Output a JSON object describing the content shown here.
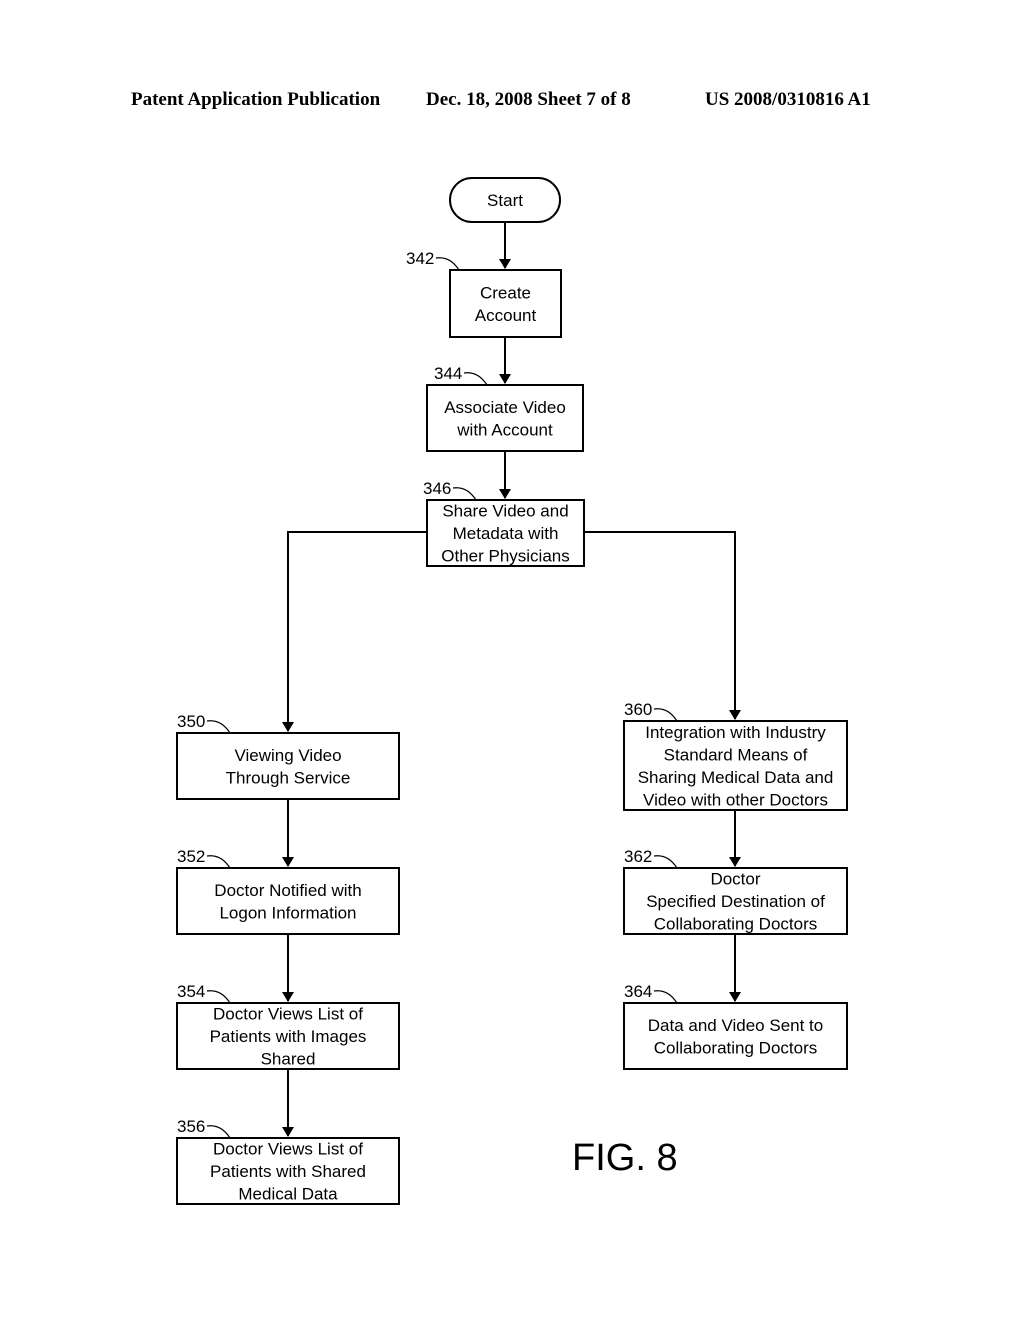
{
  "header": {
    "left": "Patent Application Publication",
    "middle": "Dec. 18, 2008   Sheet 7 of 8",
    "right": "US 2008/0310816 A1"
  },
  "figure_label": "FIG. 8",
  "start": {
    "label": "Start"
  },
  "steps": {
    "s342": {
      "ref": "342",
      "lines": [
        "Create",
        "Account"
      ]
    },
    "s344": {
      "ref": "344",
      "lines": [
        "Associate Video",
        "with Account"
      ]
    },
    "s346": {
      "ref": "346",
      "lines": [
        "Share Video and",
        "Metadata with",
        "Other Physicians"
      ]
    },
    "s350": {
      "ref": "350",
      "lines": [
        "Viewing Video",
        "Through Service"
      ]
    },
    "s352": {
      "ref": "352",
      "lines": [
        "Doctor Notified with",
        "Logon Information"
      ]
    },
    "s354": {
      "ref": "354",
      "lines": [
        "Doctor Views List of",
        "Patients with Images",
        "Shared"
      ]
    },
    "s356": {
      "ref": "356",
      "lines": [
        "Doctor Views List of",
        "Patients with Shared",
        "Medical Data"
      ]
    },
    "s360": {
      "ref": "360",
      "lines": [
        "Integration with Industry",
        "Standard Means of",
        "Sharing Medical Data and",
        "Video with other Doctors"
      ]
    },
    "s362": {
      "ref": "362",
      "lines": [
        "Doctor",
        "Specified Destination of",
        "Collaborating Doctors"
      ]
    },
    "s364": {
      "ref": "364",
      "lines": [
        "Data and Video Sent to",
        "Collaborating Doctors"
      ]
    }
  }
}
